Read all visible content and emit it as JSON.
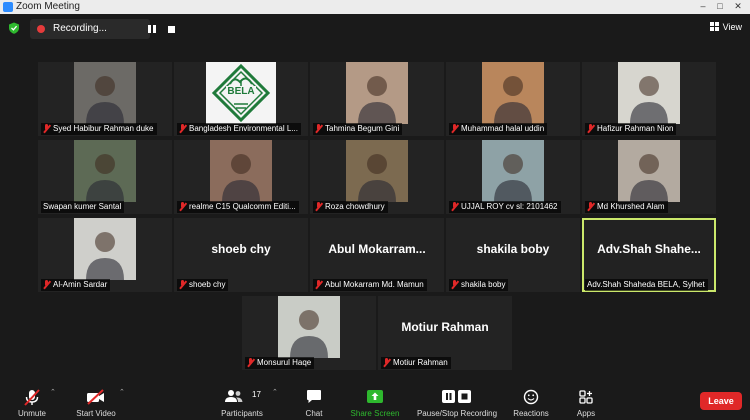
{
  "window": {
    "title": "Zoom Meeting"
  },
  "recording": {
    "label": "Recording..."
  },
  "view": {
    "label": "View"
  },
  "participants": [
    {
      "label": "Syed Habibur Rahman duke",
      "muted": true,
      "kind": "video",
      "bg": "#6c6a66"
    },
    {
      "label": "Bangladesh Environmental L...",
      "muted": true,
      "kind": "logo",
      "bg": "#f4f4f4"
    },
    {
      "label": "Tahmina Begum Gini",
      "muted": true,
      "kind": "video",
      "bg": "#b49a86"
    },
    {
      "label": "Muhammad halal uddin",
      "muted": true,
      "kind": "video",
      "bg": "#b9865c"
    },
    {
      "label": "Hafizur Rahman Nion",
      "muted": true,
      "kind": "video",
      "bg": "#d7d6cf"
    },
    {
      "label": "Swapan kumer Santal",
      "muted": false,
      "kind": "video",
      "bg": "#5d6a55"
    },
    {
      "label": "realme C15 Qualcomm Editi...",
      "muted": true,
      "kind": "video",
      "bg": "#8b6c5c"
    },
    {
      "label": "Roza chowdhury",
      "muted": true,
      "kind": "video",
      "bg": "#7c6a50"
    },
    {
      "label": "UJJAL ROY cv sl: 2101462",
      "muted": true,
      "kind": "video",
      "bg": "#8ea2a6"
    },
    {
      "label": "Md Khurshed Alam",
      "muted": true,
      "kind": "video",
      "bg": "#b3aaa0"
    },
    {
      "label": "Al-Amin Sardar",
      "muted": true,
      "kind": "video",
      "bg": "#cfcfcb"
    },
    {
      "label": "shoeb chy",
      "muted": true,
      "kind": "name",
      "big": "shoeb chy"
    },
    {
      "label": "Abul Mokarram Md. Mamun",
      "muted": true,
      "kind": "name",
      "big": "Abul  Mokarram..."
    },
    {
      "label": "shakila boby",
      "muted": true,
      "kind": "name",
      "big": "shakila boby"
    },
    {
      "label": "Adv.Shah Shaheda BELA, Sylhet",
      "muted": false,
      "kind": "name",
      "big": "Adv.Shah  Shahe...",
      "active": true
    },
    {
      "label": "Monsurul Haqe",
      "muted": true,
      "kind": "video",
      "bg": "#c9ccc6"
    },
    {
      "label": "Motiur Rahman",
      "muted": true,
      "kind": "name",
      "big": "Motiur Rahman"
    }
  ],
  "bela_logo": {
    "text": "BELA",
    "color": "#1f7a3a"
  },
  "toolbar": {
    "unmute": "Unmute",
    "start_video": "Start Video",
    "participants": "Participants",
    "participant_count": "17",
    "chat": "Chat",
    "share_screen": "Share Screen",
    "pause_stop": "Pause/Stop Recording",
    "reactions": "Reactions",
    "apps": "Apps",
    "leave": "Leave"
  },
  "colors": {
    "accent_green": "#2eb82e",
    "leave_red": "#e02828",
    "active_outline": "#cbe86b"
  }
}
